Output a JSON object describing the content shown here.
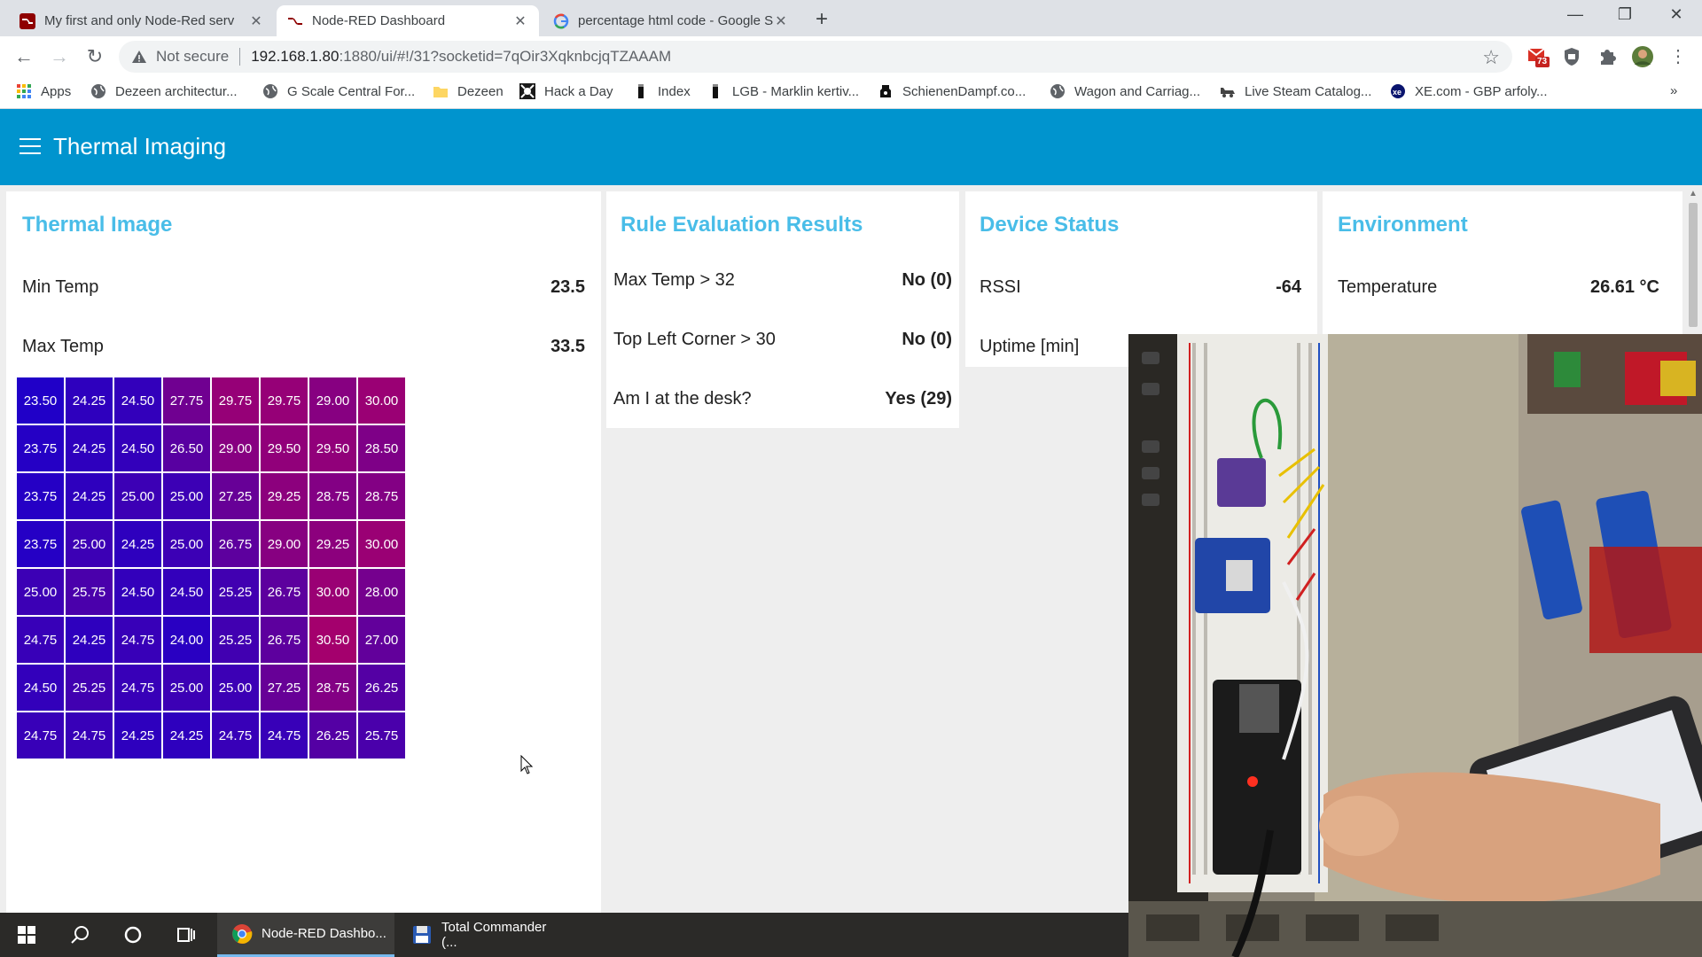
{
  "browser": {
    "tabs": [
      {
        "label": "My first and only Node-Red serv",
        "active": false
      },
      {
        "label": "Node-RED Dashboard",
        "active": true
      },
      {
        "label": "percentage html code - Google S",
        "active": false
      }
    ],
    "new_tab_icon": "plus-icon",
    "address": {
      "security_label": "Not secure",
      "host": "192.168.1.80",
      "path": ":1880/ui/#!/31?socketid=7qOir3XqknbcjqTZAAAM"
    },
    "extension_badge": "73",
    "bookmarks": [
      {
        "label": "Apps",
        "icon": "apps-grid-icon"
      },
      {
        "label": "Dezeen architectur...",
        "icon": "globe-icon"
      },
      {
        "label": "G Scale Central For...",
        "icon": "globe-icon"
      },
      {
        "label": "Dezeen",
        "icon": "folder-icon"
      },
      {
        "label": "Hack a Day",
        "icon": "hackaday-icon"
      },
      {
        "label": "Index",
        "icon": "bookmark-icon"
      },
      {
        "label": "LGB - Marklin kertiv...",
        "icon": "bookmark-icon"
      },
      {
        "label": "SchienenDampf.co...",
        "icon": "train-icon"
      },
      {
        "label": "Wagon and Carriag...",
        "icon": "globe-icon"
      },
      {
        "label": "Live Steam Catalog...",
        "icon": "steam-icon"
      },
      {
        "label": "XE.com - GBP arfoly...",
        "icon": "xe-icon"
      }
    ],
    "overflow": "»"
  },
  "dashboard": {
    "title": "Thermal Imaging",
    "accent_color": "#0094ce",
    "title_color": "#49bde8",
    "thermal": {
      "title": "Thermal Image",
      "min_label": "Min Temp",
      "min_value": "23.5",
      "max_label": "Max Temp",
      "max_value": "33.5",
      "grid": [
        [
          "23.50",
          "24.25",
          "24.50",
          "27.75",
          "29.75",
          "29.75",
          "29.00",
          "30.00"
        ],
        [
          "23.75",
          "24.25",
          "24.50",
          "26.50",
          "29.00",
          "29.50",
          "29.50",
          "28.50"
        ],
        [
          "23.75",
          "24.25",
          "25.00",
          "25.00",
          "27.25",
          "29.25",
          "28.75",
          "28.75"
        ],
        [
          "23.75",
          "25.00",
          "24.25",
          "25.00",
          "26.75",
          "29.00",
          "29.25",
          "30.00"
        ],
        [
          "25.00",
          "25.75",
          "24.50",
          "24.50",
          "25.25",
          "26.75",
          "30.00",
          "28.00"
        ],
        [
          "24.75",
          "24.25",
          "24.75",
          "24.00",
          "25.25",
          "26.75",
          "30.50",
          "27.00"
        ],
        [
          "24.50",
          "25.25",
          "24.75",
          "25.00",
          "25.00",
          "27.25",
          "28.75",
          "26.25"
        ],
        [
          "24.75",
          "24.75",
          "24.25",
          "24.25",
          "24.75",
          "24.75",
          "26.25",
          "25.75"
        ]
      ]
    },
    "rules": {
      "title": "Rule Evaluation Results",
      "items": [
        {
          "label": "Max Temp > 32",
          "value": "No (0)"
        },
        {
          "label": "Top Left Corner > 30",
          "value": "No (0)"
        },
        {
          "label": "Am I at the desk?",
          "value": "Yes (29)"
        }
      ]
    },
    "device": {
      "title": "Device Status",
      "rssi_label": "RSSI",
      "rssi_value": "-64",
      "uptime_label": "Uptime [min]"
    },
    "environment": {
      "title": "Environment",
      "temp_label": "Temperature",
      "temp_value": "26.61 °C"
    }
  },
  "taskbar": {
    "apps": [
      {
        "label": "Node-RED Dashbo...",
        "active": true
      },
      {
        "label": "Total Commander (...",
        "active": false
      }
    ]
  }
}
